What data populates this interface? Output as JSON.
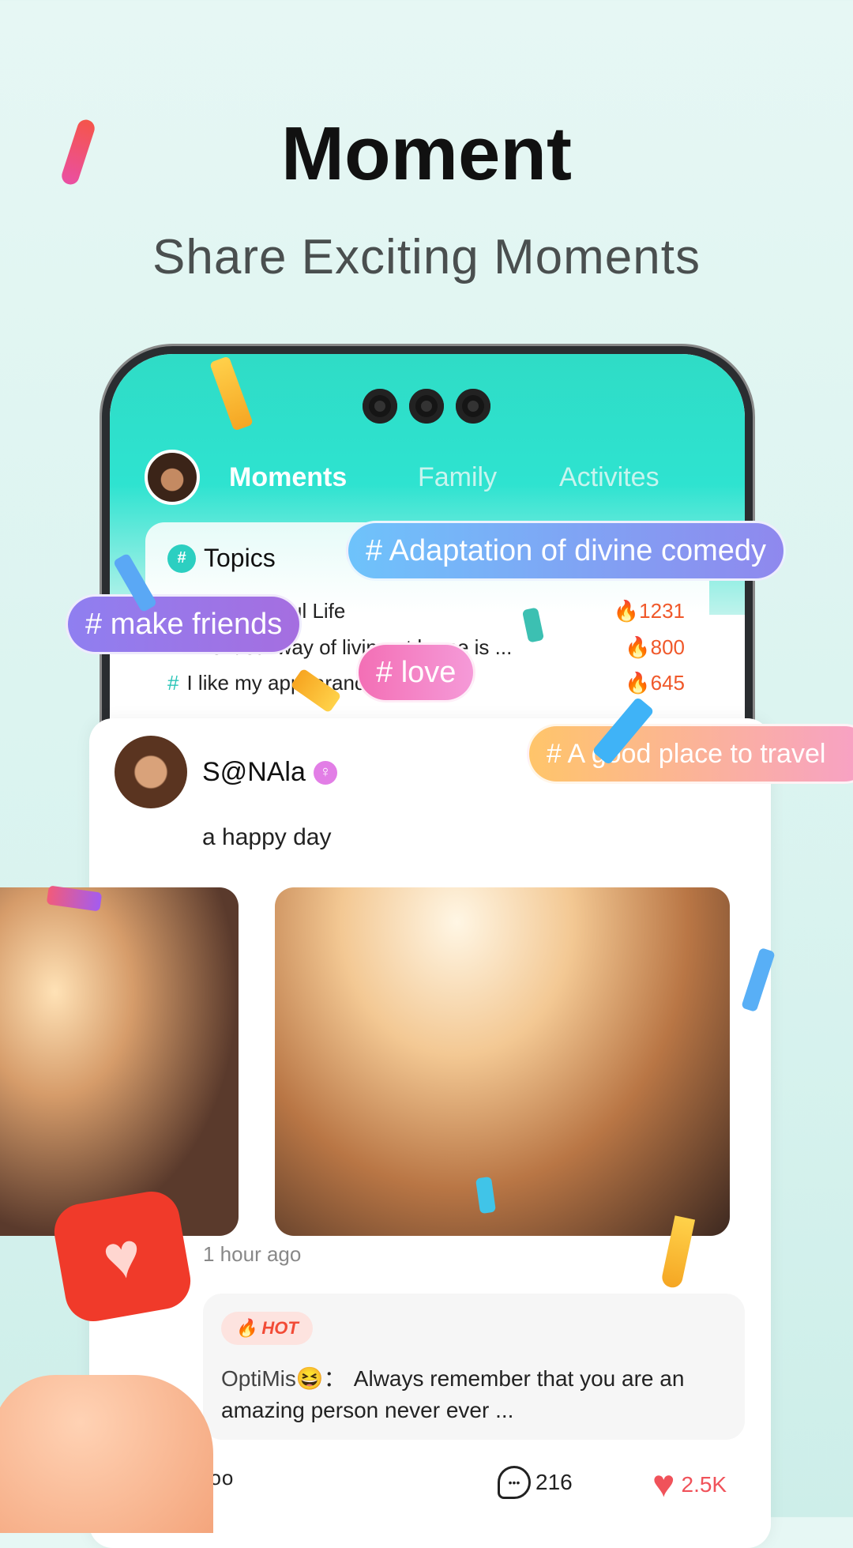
{
  "header": {
    "title": "Moment",
    "subtitle": "Share Exciting Moments"
  },
  "app": {
    "tabs": [
      {
        "label": "Moments",
        "active": true
      },
      {
        "label": "Family",
        "active": false
      },
      {
        "label": "Activites",
        "active": false
      }
    ],
    "topics": {
      "title": "Topics",
      "icon": "hash-bubble-icon",
      "rows": [
        {
          "label": "Our Beautiful Life",
          "count": "1231"
        },
        {
          "label": "The ideal way of living at home is ...",
          "count": "800"
        },
        {
          "label": "I like my appearance",
          "count": "645"
        }
      ]
    },
    "tags": [
      "# Adaptation of divine comedy",
      "# make friends",
      "# love",
      "# A good place to travel"
    ],
    "post": {
      "name": "S@NAla",
      "gender_icon": "female-icon",
      "text": "a happy day",
      "time": "1 hour ago",
      "hot_label": "HOT",
      "comment_user": "OptiMis",
      "comment_emoji": "😆",
      "comment_sep": "：",
      "comment_text": "Always remember that you are an amazing person never ever ...",
      "comments": "216",
      "likes": "2.5K"
    }
  },
  "colors": {
    "accent": "#2ee3d0",
    "hot": "#f24b36",
    "like": "#f0525a"
  }
}
